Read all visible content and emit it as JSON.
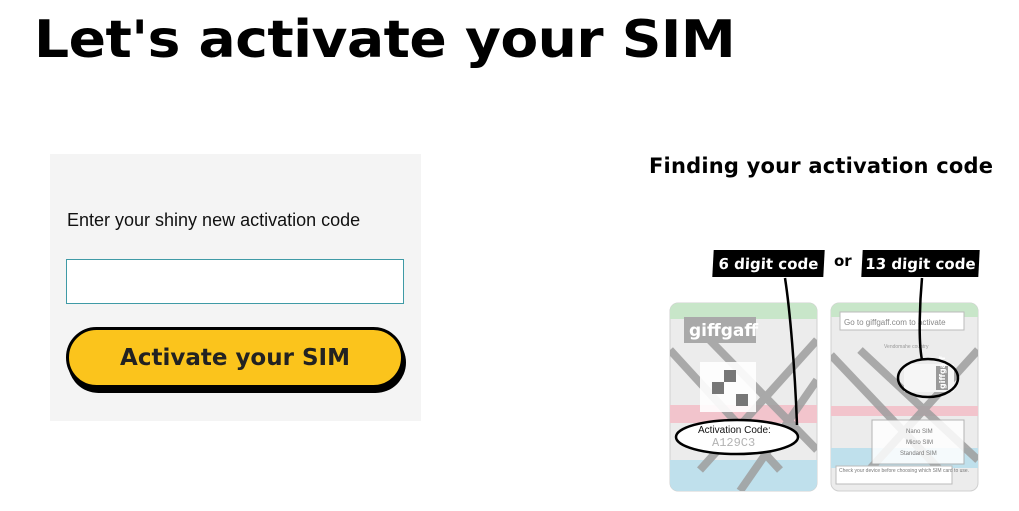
{
  "page": {
    "title": "Let's activate your SIM"
  },
  "form": {
    "label": "Enter your shiny new activation code",
    "input_value": "",
    "input_placeholder": "",
    "button_label": "Activate your SIM"
  },
  "help": {
    "title": "Finding your activation code",
    "tag_left": "6 digit code",
    "or_text": "or",
    "tag_right": "13 digit code",
    "card_left": {
      "brand": "giffgaff",
      "activation_label": "Activation Code:",
      "activation_value": "A129C3"
    },
    "card_right": {
      "goto_text": "Go to giffgaff.com to activate",
      "small_text": "Vendomahe country",
      "sizes": [
        "Nano SIM",
        "Micro SIM",
        "Standard SIM"
      ],
      "footer": "Check your device before choosing which SIM card to use.",
      "brand": "giffgaff"
    }
  },
  "colors": {
    "button": "#fbc41c",
    "panel": "#f4f4f4",
    "input_border": "#3f9aa6"
  }
}
